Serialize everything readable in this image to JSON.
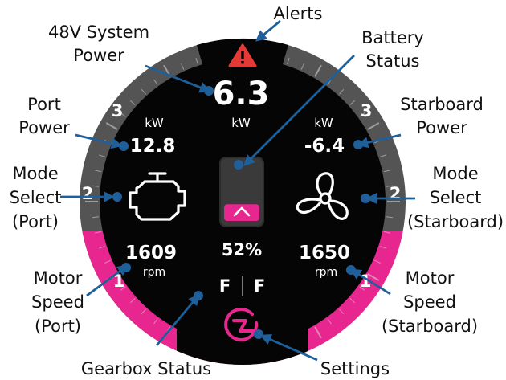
{
  "colors": {
    "accent": "#e8268f",
    "bezel": "#545454",
    "dial": "#050505",
    "callout": "#1f5f9a",
    "alert": "#e53935"
  },
  "gauge": {
    "center_value": "6.3",
    "center_unit": "kW",
    "port_unit": "kW",
    "port_power": "12.8",
    "starboard_unit": "kW",
    "starboard_power": "-6.4",
    "port_rpm": "1609",
    "port_rpm_unit": "rpm",
    "starboard_rpm": "1650",
    "starboard_rpm_unit": "rpm",
    "battery_percent": "52%",
    "battery_level": 0.52,
    "gear_port": "F",
    "gear_starboard": "F",
    "scale_left": [
      "3",
      "2",
      "1"
    ],
    "scale_right": [
      "3",
      "2",
      "1"
    ],
    "icons": {
      "alert": "alert-triangle-icon",
      "port_mode": "engine-icon",
      "starboard_mode": "propeller-fan-icon",
      "settings": "settings-lightning-icon",
      "battery_up": "chevron-up-icon"
    }
  },
  "annotations": {
    "alerts": "Alerts",
    "system_power": [
      "48V System",
      "Power"
    ],
    "battery_status": [
      "Battery",
      "Status"
    ],
    "port_power": [
      "Port",
      "Power"
    ],
    "starboard_power": [
      "Starboard",
      "Power"
    ],
    "mode_port": [
      "Mode",
      "Select",
      "(Port)"
    ],
    "mode_starboard": [
      "Mode",
      "Select",
      "(Starboard)"
    ],
    "speed_port": [
      "Motor",
      "Speed",
      "(Port)"
    ],
    "speed_starboard": [
      "Motor",
      "Speed",
      "(Starboard)"
    ],
    "gearbox": "Gearbox Status",
    "settings": "Settings"
  }
}
